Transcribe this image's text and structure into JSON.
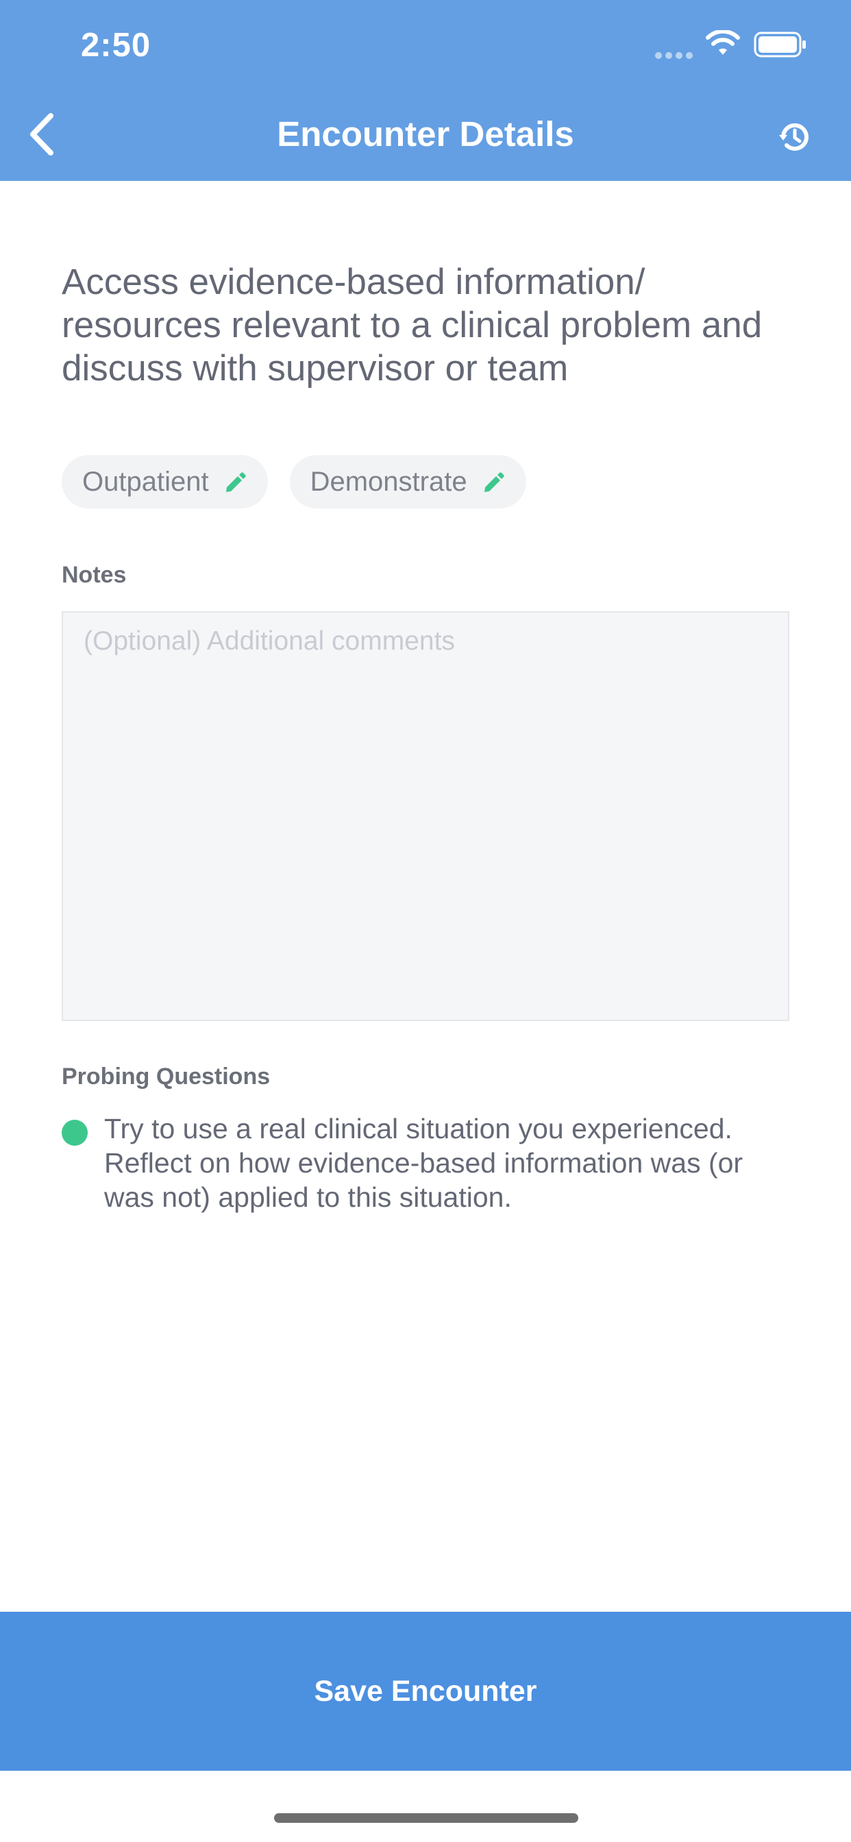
{
  "status_bar": {
    "time": "2:50"
  },
  "header": {
    "title": "Encounter Details",
    "back_icon": "chevron-left-icon",
    "history_icon": "history-icon"
  },
  "encounter": {
    "description": "Access evidence-based information/ resources relevant to a clinical problem and discuss with supervisor or team",
    "tags": [
      {
        "label": "Outpatient",
        "icon": "pencil-icon"
      },
      {
        "label": "Demonstrate",
        "icon": "pencil-icon"
      }
    ]
  },
  "notes": {
    "label": "Notes",
    "placeholder": "(Optional) Additional comments",
    "value": ""
  },
  "probing": {
    "label": "Probing Questions",
    "items": [
      {
        "text": "Try to use a real clinical situation you experienced. Reflect on how evidence-based information was (or was not) applied to this situation."
      }
    ]
  },
  "footer": {
    "save_label": "Save Encounter"
  },
  "colors": {
    "header": "#649fe3",
    "save_button": "#4c90e0",
    "accent_green": "#3dc78d",
    "text_gray": "#646875"
  }
}
